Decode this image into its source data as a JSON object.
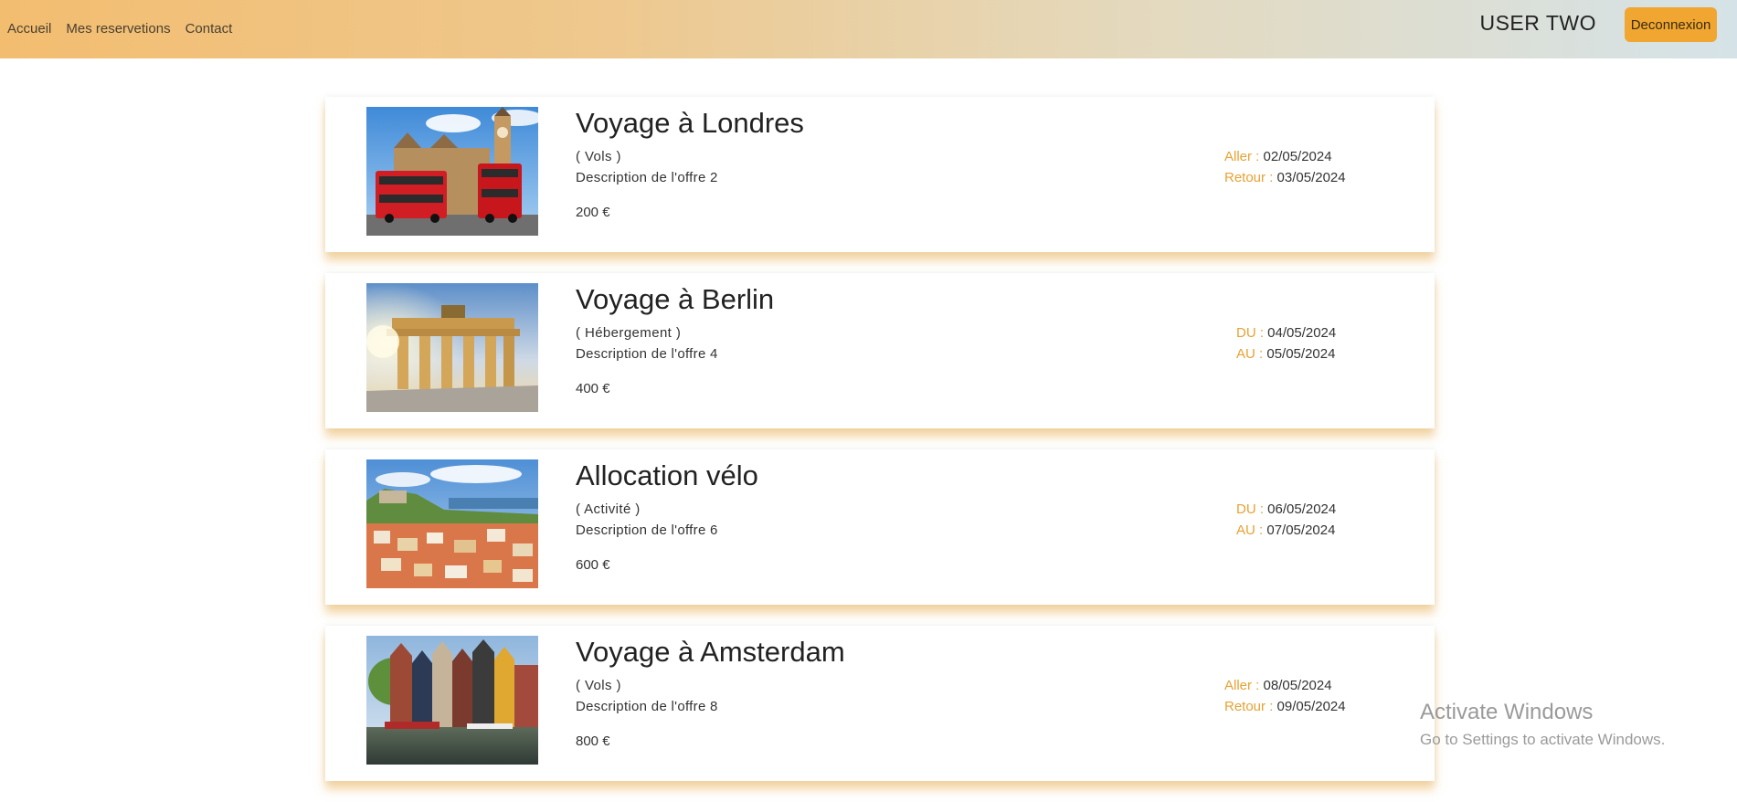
{
  "nav": {
    "links": [
      "Accueil",
      "Mes reservetions",
      "Contact"
    ],
    "user": "USER TWO",
    "logout": "Deconnexion"
  },
  "reservations": [
    {
      "title": "Voyage à Londres",
      "type": "( Vols )",
      "description": "Description de l'offre 2",
      "price": "200 €",
      "date1_label": "Aller :",
      "date1": "02/05/2024",
      "date2_label": "Retour :",
      "date2": "03/05/2024",
      "image": "london-bus-big-ben"
    },
    {
      "title": "Voyage à Berlin",
      "type": "( Hébergement )",
      "description": "Description de l'offre 4",
      "price": "400 €",
      "date1_label": "DU :",
      "date1": "04/05/2024",
      "date2_label": "AU :",
      "date2": "05/05/2024",
      "image": "brandenburg-gate"
    },
    {
      "title": "Allocation vélo",
      "type": "( Activité )",
      "description": "Description de l'offre 6",
      "price": "600 €",
      "date1_label": "DU :",
      "date1": "06/05/2024",
      "date2_label": "AU :",
      "date2": "07/05/2024",
      "image": "lisbon-cityscape"
    },
    {
      "title": "Voyage à Amsterdam",
      "type": "( Vols )",
      "description": "Description de l'offre 8",
      "price": "800 €",
      "date1_label": "Aller :",
      "date1": "08/05/2024",
      "date2_label": "Retour :",
      "date2": "09/05/2024",
      "image": "amsterdam-canal-houses"
    }
  ],
  "watermark": {
    "title": "Activate Windows",
    "subtitle": "Go to Settings to activate Windows."
  },
  "colors": {
    "accent": "#f0a630",
    "date_label": "#e8a132"
  }
}
